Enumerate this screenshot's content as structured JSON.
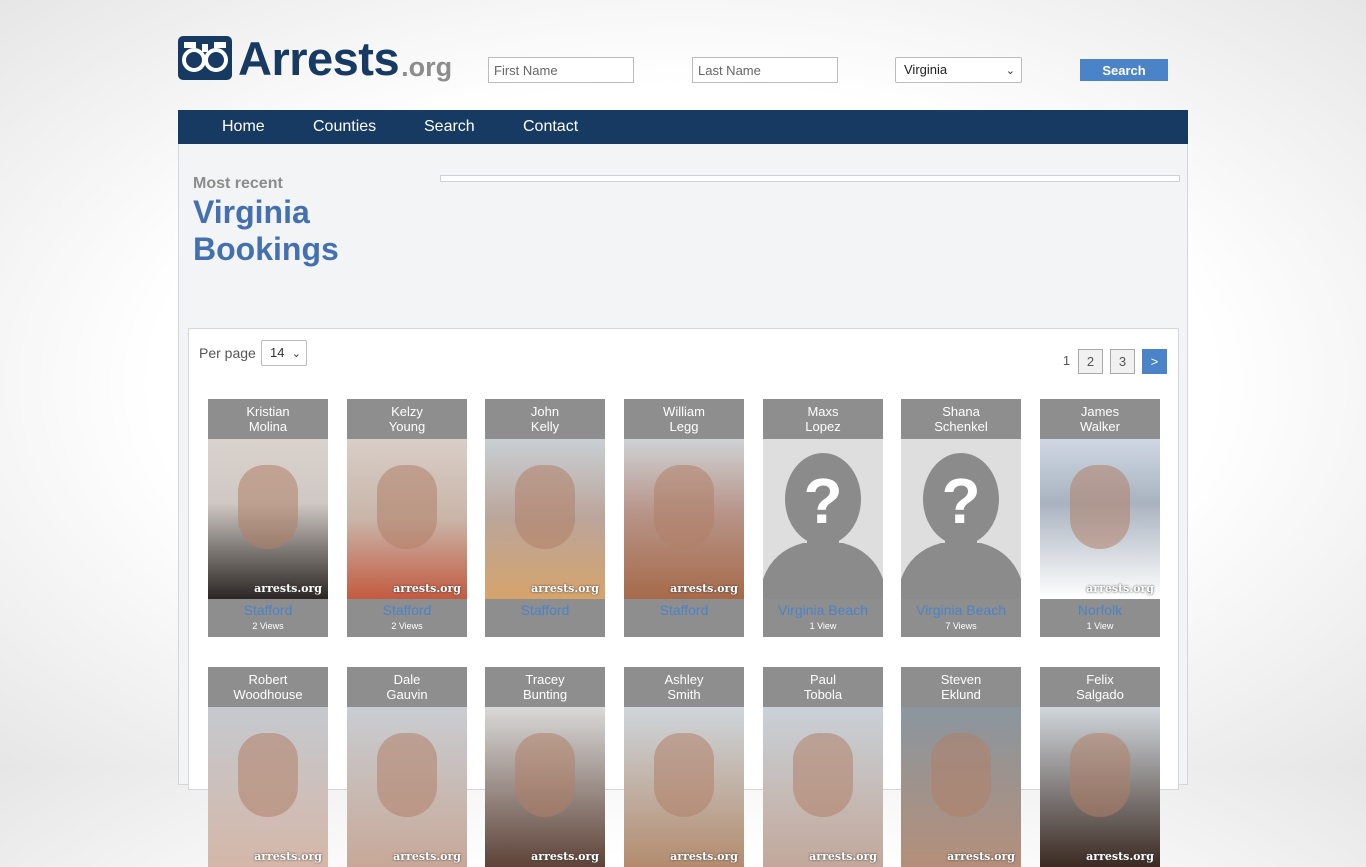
{
  "logo": {
    "name": "Arrests",
    "tld": ".org"
  },
  "search": {
    "first_placeholder": "First Name",
    "last_placeholder": "Last Name",
    "state": "Virginia",
    "button": "Search"
  },
  "nav": {
    "items": [
      "Home",
      "Counties",
      "Search",
      "Contact"
    ]
  },
  "page": {
    "kicker": "Most recent",
    "title_line1": "Virginia",
    "title_line2": "Bookings"
  },
  "listing": {
    "per_page_label": "Per page",
    "per_page_value": "14",
    "pages": [
      "1",
      "2",
      "3",
      ">"
    ]
  },
  "bookings": [
    {
      "first": "Kristian",
      "last": "Molina",
      "county": "Stafford",
      "views": "2 Views"
    },
    {
      "first": "Kelzy",
      "last": "Young",
      "county": "Stafford",
      "views": "2 Views"
    },
    {
      "first": "John",
      "last": "Kelly",
      "county": "Stafford",
      "views": ""
    },
    {
      "first": "William",
      "last": "Legg",
      "county": "Stafford",
      "views": ""
    },
    {
      "first": "Maxs",
      "last": "Lopez",
      "county": "Virginia Beach",
      "views": "1 View"
    },
    {
      "first": "Shana",
      "last": "Schenkel",
      "county": "Virginia Beach",
      "views": "7 Views"
    },
    {
      "first": "James",
      "last": "Walker",
      "county": "Norfolk",
      "views": "1 View"
    },
    {
      "first": "Robert",
      "last": "Woodhouse",
      "county": "",
      "views": ""
    },
    {
      "first": "Dale",
      "last": "Gauvin",
      "county": "",
      "views": ""
    },
    {
      "first": "Tracey",
      "last": "Bunting",
      "county": "",
      "views": ""
    },
    {
      "first": "Ashley",
      "last": "Smith",
      "county": "",
      "views": ""
    },
    {
      "first": "Paul",
      "last": "Tobola",
      "county": "",
      "views": ""
    },
    {
      "first": "Steven",
      "last": "Eklund",
      "county": "",
      "views": ""
    },
    {
      "first": "Felix",
      "last": "Salgado",
      "county": "",
      "views": ""
    }
  ],
  "watermark": "arrests.org",
  "colors": {
    "navy": "#173a62",
    "accent": "#4b83c8",
    "card_gray": "#8e8e8e"
  }
}
